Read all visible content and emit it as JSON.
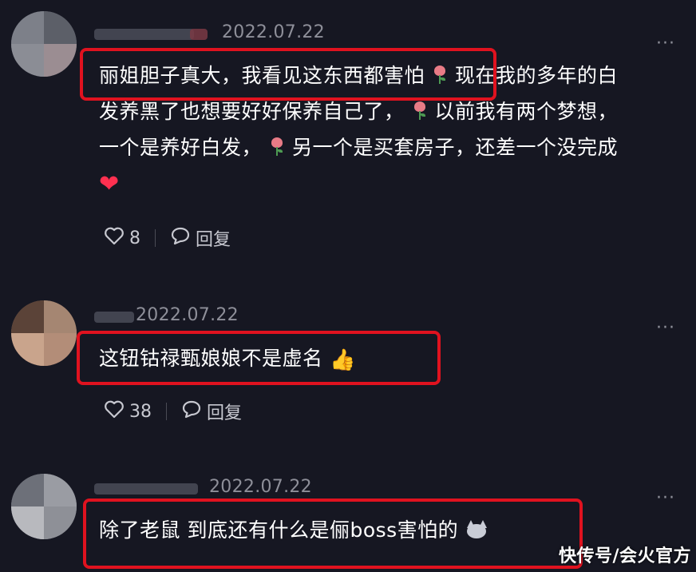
{
  "comments": [
    {
      "date": "2022.07.22",
      "text_lines": [
        "丽姐胆子真大，我看见这东西都害怕",
        "现在我的多年的白",
        "发养黑了也想要好好保养自己了，",
        "以前我有两个梦想，",
        "一个是养好白发，",
        "另一个是买套房子，还差一个没完成"
      ],
      "likes": "8",
      "reply_label": "回复"
    },
    {
      "date": "2022.07.22",
      "text": "这钮钴禄甄娘娘不是虚名",
      "likes": "38",
      "reply_label": "回复"
    },
    {
      "date": "2022.07.22",
      "text": "除了老鼠 到底还有什么是俪boss害怕的"
    }
  ],
  "more_label": "···",
  "watermark": "快传号/会火官方",
  "colors": {
    "background": "#161722",
    "highlight": "#e0121f",
    "muted": "#8e8f99"
  },
  "icons": [
    "heart-outline-icon",
    "comment-bubble-icon",
    "more-dots-icon",
    "rose-emoji",
    "red-heart-emoji",
    "thumbs-up-emoji",
    "cat-emoji"
  ]
}
